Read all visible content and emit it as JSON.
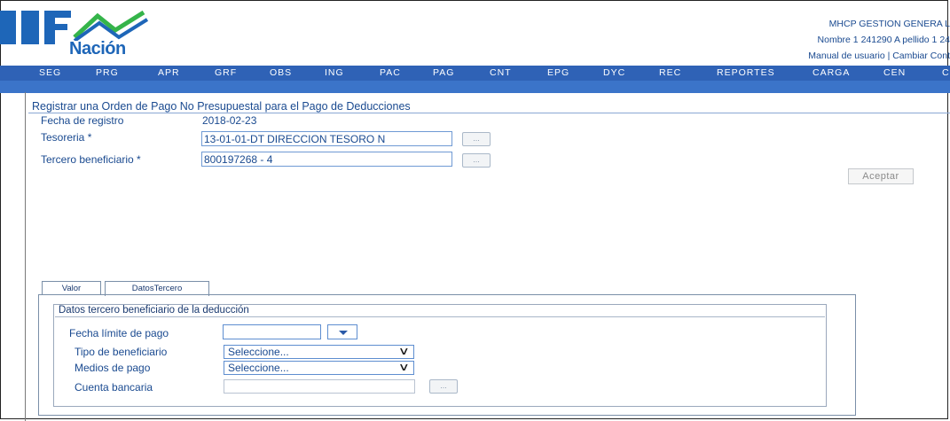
{
  "header": {
    "logo_text": "Nación",
    "user": {
      "org": "MHCP GESTION GENERA L",
      "name": "Nombre 1 241290 A pellido 1 24",
      "links": "Manual de usuario | Cambiar Cont"
    }
  },
  "nav": {
    "items": [
      "SEG",
      "PRG",
      "APR",
      "GRF",
      "OBS",
      "ING",
      "PAC",
      "PAG",
      "CNT",
      "EPG",
      "DYC",
      "REC",
      "REPORTES",
      "CARGA",
      "CEN",
      "C"
    ]
  },
  "form": {
    "title": "Registrar una Orden de Pago No Presupuestal para el Pago de Deducciones",
    "fecha_label": "Fecha de registro",
    "fecha_value": "2018-02-23",
    "tesoreria_label": "Tesoreria *",
    "tesoreria_value": "13-01-01-DT DIRECCION TESORO N",
    "tercero_label": "Tercero beneficiario *",
    "tercero_value": "800197268 - 4",
    "lookup_label": "...",
    "accept_label": "Aceptar"
  },
  "tabs": [
    {
      "label": "Valor",
      "active": false
    },
    {
      "label": "DatosTercero",
      "active": true
    }
  ],
  "panel": {
    "group_title": "Datos tercero beneficiario de la deducción",
    "fecha_limite_label": "Fecha límite de pago",
    "tipo_label": "Tipo de beneficiario",
    "tipo_value": "Seleccione...",
    "medios_label": "Medios de pago",
    "medios_value": "Seleccione...",
    "cuenta_label": "Cuenta bancaria",
    "lookup_label": "..."
  },
  "icons": {
    "logo": "iif-nacion-logo-icon",
    "dropdown": "chevron-down-icon",
    "calendar_drop": "triangle-down-icon"
  },
  "colors": {
    "nav_bg": "#2f62b6",
    "subbar_bg": "#3b74c9",
    "logo_blue": "#1e66b8",
    "logo_green": "#35b44a",
    "text_blue": "#1a4a90"
  }
}
